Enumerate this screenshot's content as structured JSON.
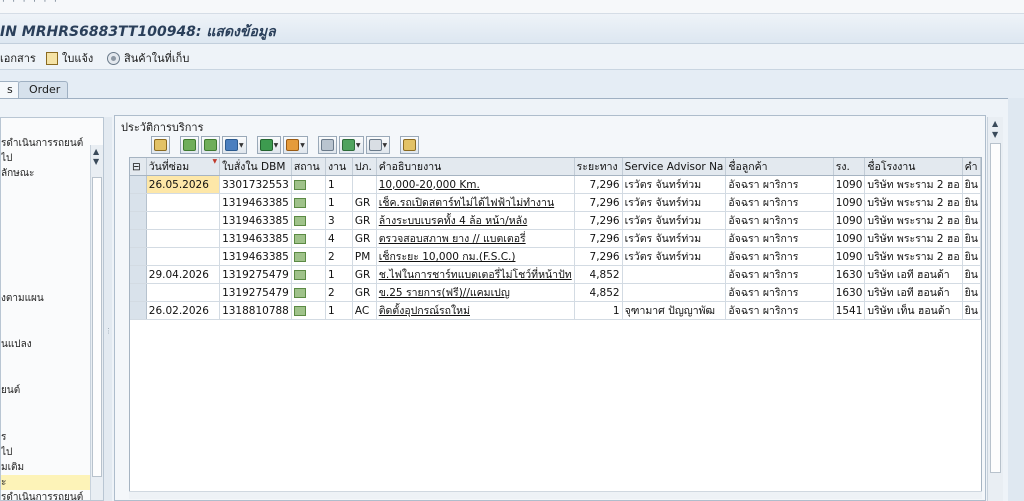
{
  "window": {
    "title": "IN MRHRS6883TT100948: แสดงข้อมูล"
  },
  "toolbar": {
    "documents_label": "เอกสาร",
    "notice_label": "ใบแจ้ง",
    "stock_label": "สินค้าในที่เก็บ"
  },
  "tabs": [
    {
      "label": "s"
    },
    {
      "label": "Order"
    }
  ],
  "left_panel": {
    "items": [
      "รดำเนินการรถยนต์",
      "ไป",
      "ลักษณะ",
      "งตามแผน",
      "นแปลง",
      "ยนต์",
      "ร",
      "ไป",
      "มเติม",
      "ะ",
      "รดำเนินการรถยนต์"
    ]
  },
  "panel": {
    "title": "ประวัติการบริการ"
  },
  "grid": {
    "columns": [
      "วันที่ซ่อม",
      "ใบสั่งใน DBM",
      "สถาน",
      "งาน",
      "ปภ.",
      "คำอธิบายงาน",
      "ระยะทาง",
      "Service Advisor Na",
      "ชื่อลูกค้า",
      "รง.",
      "ชื่อโรงงาน",
      "คำ"
    ],
    "rows": [
      {
        "date": "26.05.2026",
        "order": "3301732553",
        "job": "1",
        "type": "",
        "desc": "10,000-20,000 Km.",
        "mileage": "7,296",
        "advisor": "เรวัตร จันทร์ท่วม",
        "customer": "อัจฉรา ผาริการ",
        "plant": "1090",
        "plant_name": "บริษัท พระราม 2 ฮอ",
        "extra": "ยิน"
      },
      {
        "date": "",
        "order": "1319463385",
        "job": "1",
        "type": "GR",
        "desc": "เช็ค.รถเปิดสตาร์ทไม่ได้ไฟฟ้าไม่ทำงาน",
        "mileage": "7,296",
        "advisor": "เรวัตร จันทร์ท่วม",
        "customer": "อัจฉรา ผาริการ",
        "plant": "1090",
        "plant_name": "บริษัท พระราม 2 ฮอ",
        "extra": "ยิน"
      },
      {
        "date": "",
        "order": "1319463385",
        "job": "3",
        "type": "GR",
        "desc": "ล้างระบบเบรคทั้ง 4 ล้อ หน้า/หลัง",
        "mileage": "7,296",
        "advisor": "เรวัตร จันทร์ท่วม",
        "customer": "อัจฉรา ผาริการ",
        "plant": "1090",
        "plant_name": "บริษัท พระราม 2 ฮอ",
        "extra": "ยิน"
      },
      {
        "date": "",
        "order": "1319463385",
        "job": "4",
        "type": "GR",
        "desc": "ตรวจสอบสภาพ ยาง // แบตเตอรี่",
        "mileage": "7,296",
        "advisor": "เรวัตร จันทร์ท่วม",
        "customer": "อัจฉรา ผาริการ",
        "plant": "1090",
        "plant_name": "บริษัท พระราม 2 ฮอ",
        "extra": "ยิน"
      },
      {
        "date": "",
        "order": "1319463385",
        "job": "2",
        "type": "PM",
        "desc": "เช็กระยะ 10,000 กม.(F.S.C.)",
        "mileage": "7,296",
        "advisor": "เรวัตร จันทร์ท่วม",
        "customer": "อัจฉรา ผาริการ",
        "plant": "1090",
        "plant_name": "บริษัท พระราม 2 ฮอ",
        "extra": "ยิน"
      },
      {
        "date": "29.04.2026",
        "order": "1319275479",
        "job": "1",
        "type": "GR",
        "desc": "ช.ไฟในการชาร์ทแบตเตอรี่ไม่โชว์ที่หน้าปัท",
        "mileage": "4,852",
        "advisor": "",
        "customer": "อัจฉรา ผาริการ",
        "plant": "1630",
        "plant_name": "บริษัท เอที ฮอนด้า",
        "extra": "ยิน"
      },
      {
        "date": "",
        "order": "1319275479",
        "job": "2",
        "type": "GR",
        "desc": "ข.25 รายการ(ฟรี)//แคมเปญ",
        "mileage": "4,852",
        "advisor": "",
        "customer": "อัจฉรา ผาริการ",
        "plant": "1630",
        "plant_name": "บริษัท เอที ฮอนด้า",
        "extra": "ยิน"
      },
      {
        "date": "26.02.2026",
        "order": "1318810788",
        "job": "1",
        "type": "AC",
        "desc": "ติดตั้งอุปกรณ์รถใหม่",
        "mileage": "1",
        "advisor": "จุฑามาศ ปัญญาพัฒ",
        "customer": "อัจฉรา ผาริการ",
        "plant": "1541",
        "plant_name": "บริษัท เท็น ฮอนด้า",
        "extra": "ยิน"
      }
    ]
  }
}
